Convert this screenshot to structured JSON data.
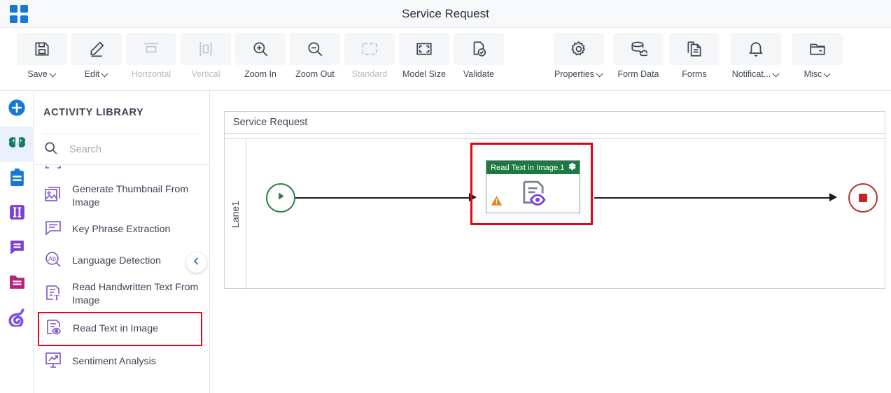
{
  "header": {
    "title": "Service Request",
    "apps_icon": "apps-grid-icon"
  },
  "toolbar": {
    "buttons": [
      {
        "label": "Save",
        "icon": "save-icon",
        "caret": true,
        "disabled": false
      },
      {
        "label": "Edit",
        "icon": "pencil-icon",
        "caret": true,
        "disabled": false
      },
      {
        "label": "Horizontal",
        "icon": "horizontal-icon",
        "caret": false,
        "disabled": true
      },
      {
        "label": "Vertical",
        "icon": "vertical-icon",
        "caret": false,
        "disabled": true
      },
      {
        "label": "Zoom In",
        "icon": "zoom-in-icon",
        "caret": false,
        "disabled": false
      },
      {
        "label": "Zoom Out",
        "icon": "zoom-out-icon",
        "caret": false,
        "disabled": false
      },
      {
        "label": "Standard",
        "icon": "standard-icon",
        "caret": false,
        "disabled": true
      },
      {
        "label": "Model Size",
        "icon": "model-size-icon",
        "caret": false,
        "disabled": false
      },
      {
        "label": "Validate",
        "icon": "validate-icon",
        "caret": false,
        "disabled": false
      },
      {
        "label": "Properties",
        "icon": "gear-icon",
        "caret": true,
        "disabled": false
      },
      {
        "label": "Form Data",
        "icon": "database-icon",
        "caret": false,
        "disabled": false
      },
      {
        "label": "Forms",
        "icon": "document-icon",
        "caret": false,
        "disabled": false
      },
      {
        "label": "Notificat...",
        "icon": "bell-icon",
        "caret": true,
        "disabled": false
      },
      {
        "label": "Misc",
        "icon": "folder-icon",
        "caret": true,
        "disabled": false
      }
    ]
  },
  "rail": {
    "items": [
      {
        "name": "add-button",
        "icon": "plus-circle-icon",
        "color": "#1678d4",
        "active": false
      },
      {
        "name": "ai-activities",
        "icon": "brain-icon",
        "color": "#0f7b5f",
        "active": true
      },
      {
        "name": "tasks",
        "icon": "clipboard-icon",
        "color": "#1678d4",
        "active": false
      },
      {
        "name": "columns",
        "icon": "columns-icon",
        "color": "#7b3fd4",
        "active": false
      },
      {
        "name": "messages",
        "icon": "comment-icon",
        "color": "#7b3fd4",
        "active": false
      },
      {
        "name": "folders",
        "icon": "folder-lines-icon",
        "color": "#b5237c",
        "active": false
      },
      {
        "name": "integrations",
        "icon": "swirl-icon",
        "color": "#7b53e8",
        "active": false
      }
    ]
  },
  "panel": {
    "title": "ACTIVITY LIBRARY",
    "search": {
      "value": "",
      "placeholder": "Search"
    },
    "collapse_icon": "chevron-left-icon",
    "items": [
      {
        "label": "",
        "icon": "face-detect-icon",
        "clipped": true,
        "selected": false
      },
      {
        "label": "Generate Thumbnail From Image",
        "icon": "image-thumbnail-icon",
        "clipped": false,
        "selected": false
      },
      {
        "label": "Key Phrase Extraction",
        "icon": "comment-lines-icon",
        "clipped": false,
        "selected": false
      },
      {
        "label": "Language Detection",
        "icon": "ab-magnifier-icon",
        "clipped": false,
        "selected": false
      },
      {
        "label": "Read Handwritten Text From Image",
        "icon": "doc-handwritten-icon",
        "clipped": false,
        "selected": false
      },
      {
        "label": "Read Text in Image",
        "icon": "doc-eye-icon",
        "clipped": false,
        "selected": true
      },
      {
        "label": "Sentiment Analysis",
        "icon": "chart-trend-icon",
        "clipped": false,
        "selected": false
      }
    ]
  },
  "canvas": {
    "pool_title": "Service Request",
    "lane_label": "Lane1",
    "start_node": {
      "icon": "play-icon",
      "color": "#2e7d46"
    },
    "end_node": {
      "icon": "stop-square-icon",
      "color": "#b8312f"
    },
    "task": {
      "title": "Read Text in Image.1",
      "gear_icon": "gear-icon",
      "warning_icon": "warning-triangle-icon",
      "body_icon": "doc-eye-icon",
      "header_color": "#1a7a3f",
      "selection_color": "#e30613"
    }
  },
  "colors": {
    "accent_blue": "#1678d4",
    "selection_red": "#e30613",
    "task_green": "#1a7a3f",
    "warning_orange": "#e8821e",
    "purple": "#7b53c9"
  }
}
